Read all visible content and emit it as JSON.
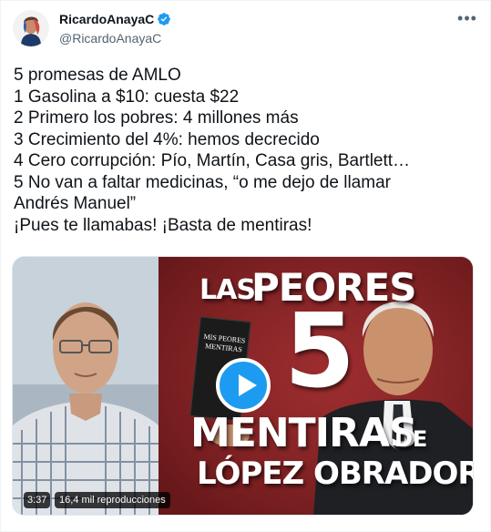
{
  "author": {
    "display_name": "RicardoAnayaC",
    "handle": "@RicardoAnayaC",
    "verified": true
  },
  "icons": {
    "more": "more-horizontal-icon",
    "verified": "verified-badge-icon",
    "play": "play-icon"
  },
  "colors": {
    "accent": "#1d9bf0",
    "text": "#0f1419",
    "secondary_text": "#536471",
    "thumbnail_red": "#8e2628"
  },
  "tweet_lines": [
    "5 promesas de AMLO",
    "1 Gasolina a $10: cuesta $22",
    "2 Primero los pobres: 4 millones más",
    "3 Crecimiento del 4%: hemos decrecido",
    "4 Cero corrupción: Pío, Martín, Casa gris, Bartlett…",
    "5 No van a faltar medicinas, “o me dejo de llamar",
    "Andrés Manuel”",
    "¡Pues te llamabas! ¡Basta de mentiras!"
  ],
  "video": {
    "duration": "3:37",
    "views": "16,4 mil reproducciones",
    "thumbnail": {
      "word_las": "LAS",
      "word_peores": "PEORES",
      "number": "5",
      "word_mentiras": "MENTIRAS",
      "word_de": "DE",
      "word_name": "LÓPEZ OBRADOR",
      "book_title": "MIS PEORES MENTIRAS"
    }
  }
}
